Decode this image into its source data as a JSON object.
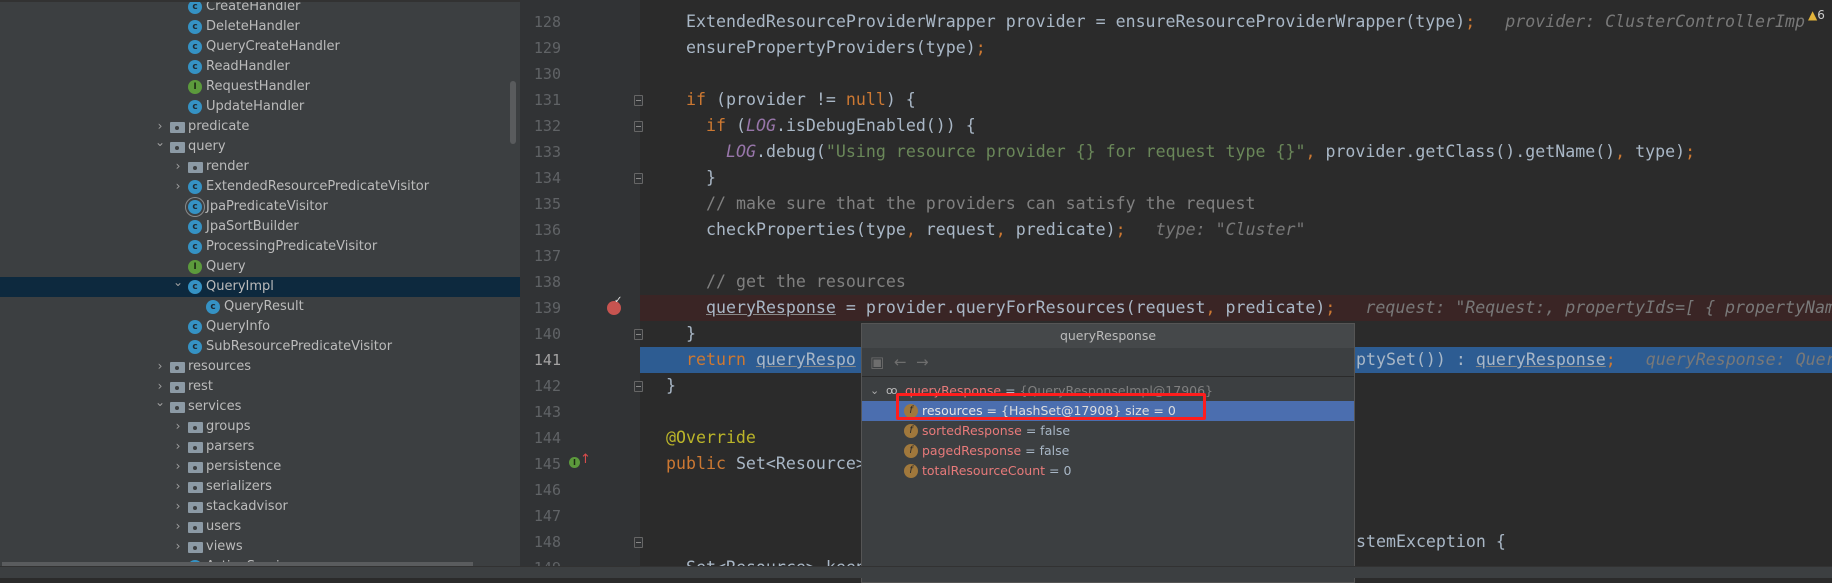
{
  "project_tree": [
    {
      "label": "CreateHandler",
      "icon": "class",
      "depth": 1,
      "expander": "none"
    },
    {
      "label": "DeleteHandler",
      "icon": "class",
      "depth": 1,
      "expander": "none"
    },
    {
      "label": "QueryCreateHandler",
      "icon": "class",
      "depth": 1,
      "expander": "none"
    },
    {
      "label": "ReadHandler",
      "icon": "class",
      "depth": 1,
      "expander": "none"
    },
    {
      "label": "RequestHandler",
      "icon": "interface",
      "depth": 1,
      "expander": "none"
    },
    {
      "label": "UpdateHandler",
      "icon": "class",
      "depth": 1,
      "expander": "none"
    },
    {
      "label": "predicate",
      "icon": "folder",
      "depth": 0,
      "expander": "collapsed"
    },
    {
      "label": "query",
      "icon": "folder",
      "depth": 0,
      "expander": "expanded"
    },
    {
      "label": "render",
      "icon": "folder",
      "depth": 1,
      "expander": "collapsed"
    },
    {
      "label": "ExtendedResourcePredicateVisitor",
      "icon": "class",
      "depth": 1,
      "expander": "collapsed"
    },
    {
      "label": "JpaPredicateVisitor",
      "icon": "abstract",
      "depth": 1,
      "expander": "none"
    },
    {
      "label": "JpaSortBuilder",
      "icon": "class",
      "depth": 1,
      "expander": "none"
    },
    {
      "label": "ProcessingPredicateVisitor",
      "icon": "class",
      "depth": 1,
      "expander": "none"
    },
    {
      "label": "Query",
      "icon": "interface",
      "depth": 1,
      "expander": "none"
    },
    {
      "label": "QueryImpl",
      "icon": "class",
      "depth": 1,
      "expander": "expanded",
      "selected": true
    },
    {
      "label": "QueryResult",
      "icon": "class",
      "depth": 2,
      "expander": "none"
    },
    {
      "label": "QueryInfo",
      "icon": "class",
      "depth": 1,
      "expander": "none"
    },
    {
      "label": "SubResourcePredicateVisitor",
      "icon": "class",
      "depth": 1,
      "expander": "none"
    },
    {
      "label": "resources",
      "icon": "folder",
      "depth": 0,
      "expander": "collapsed"
    },
    {
      "label": "rest",
      "icon": "folder",
      "depth": 0,
      "expander": "collapsed"
    },
    {
      "label": "services",
      "icon": "folder",
      "depth": 0,
      "expander": "expanded"
    },
    {
      "label": "groups",
      "icon": "folder",
      "depth": 1,
      "expander": "collapsed"
    },
    {
      "label": "parsers",
      "icon": "folder",
      "depth": 1,
      "expander": "collapsed"
    },
    {
      "label": "persistence",
      "icon": "folder",
      "depth": 1,
      "expander": "collapsed"
    },
    {
      "label": "serializers",
      "icon": "folder",
      "depth": 1,
      "expander": "collapsed"
    },
    {
      "label": "stackadvisor",
      "icon": "folder",
      "depth": 1,
      "expander": "collapsed"
    },
    {
      "label": "users",
      "icon": "folder",
      "depth": 1,
      "expander": "collapsed"
    },
    {
      "label": "views",
      "icon": "folder",
      "depth": 1,
      "expander": "collapsed"
    },
    {
      "label": "ActionService",
      "icon": "class",
      "depth": 1,
      "expander": "none"
    }
  ],
  "editor": {
    "warning_count": "6",
    "current_line": 141,
    "breakpoint_line": 139,
    "lines": [
      {
        "n": "128",
        "indent": 1,
        "tokens": [
          [
            "ExtendedResourceProviderWrapper provider = ensureResourceProviderWrapper(type)",
            ""
          ],
          [
            ";",
            "sep"
          ]
        ],
        "hint": "provider: ClusterControllerImp"
      },
      {
        "n": "129",
        "indent": 1,
        "tokens": [
          [
            "ensurePropertyProviders(type)",
            ""
          ],
          [
            ";",
            "sep"
          ]
        ]
      },
      {
        "n": "130",
        "indent": 1,
        "tokens": []
      },
      {
        "n": "131",
        "indent": 1,
        "fold": true,
        "tokens": [
          [
            "if",
            "kw"
          ],
          [
            " (provider != ",
            ""
          ],
          [
            "null",
            "kw"
          ],
          [
            ") {",
            ""
          ]
        ]
      },
      {
        "n": "132",
        "indent": 2,
        "fold": true,
        "tokens": [
          [
            "if",
            "kw"
          ],
          [
            " (",
            ""
          ],
          [
            "LOG",
            "log"
          ],
          [
            ".isDebugEnabled()) {",
            ""
          ]
        ]
      },
      {
        "n": "133",
        "indent": 3,
        "tokens": [
          [
            "LOG",
            "log"
          ],
          [
            ".debug(",
            ""
          ],
          [
            "\"Using resource provider {} for request type {}\"",
            "str"
          ],
          [
            ", ",
            "sep"
          ],
          [
            "provider.getClass().getName()",
            ""
          ],
          [
            ", ",
            "sep"
          ],
          [
            "type)",
            ""
          ],
          [
            ";",
            "sep"
          ]
        ]
      },
      {
        "n": "134",
        "indent": 2,
        "fold": true,
        "tokens": [
          [
            "}",
            ""
          ]
        ]
      },
      {
        "n": "135",
        "indent": 2,
        "tokens": [
          [
            "// make sure that the providers can satisfy the request",
            "cm"
          ]
        ]
      },
      {
        "n": "136",
        "indent": 2,
        "tokens": [
          [
            "checkProperties(type",
            ""
          ],
          [
            ", ",
            "sep"
          ],
          [
            "request",
            ""
          ],
          [
            ", ",
            "sep"
          ],
          [
            "predicate)",
            ""
          ],
          [
            ";",
            "sep"
          ]
        ],
        "hint": "type: \"Cluster\""
      },
      {
        "n": "137",
        "indent": 2,
        "tokens": []
      },
      {
        "n": "138",
        "indent": 2,
        "tokens": [
          [
            "// get the resources",
            "cm"
          ]
        ]
      },
      {
        "n": "139",
        "indent": 2,
        "tokens": [
          [
            "queryResponse",
            "ul"
          ],
          [
            " = provider.queryForResources(request",
            ""
          ],
          [
            ", ",
            "sep"
          ],
          [
            "predicate)",
            ""
          ],
          [
            ";",
            "sep"
          ]
        ],
        "hint": "request: \"Request:, propertyIds=[ { propertyName"
      },
      {
        "n": "140",
        "indent": 1,
        "fold": true,
        "tokens": [
          [
            "}",
            ""
          ]
        ]
      },
      {
        "n": "141",
        "indent": 1,
        "tokens": [
          [
            "return ",
            "kw"
          ],
          [
            "queryRespo",
            "ul"
          ]
        ],
        "right_tokens": [
          [
            "ptySet()) : ",
            ""
          ],
          [
            "queryResponse",
            "ul"
          ],
          [
            ";",
            "sep"
          ]
        ],
        "hint": "queryResponse: Quer"
      },
      {
        "n": "142",
        "indent": 0,
        "fold": true,
        "tokens": [
          [
            "}",
            ""
          ]
        ]
      },
      {
        "n": "143",
        "indent": 0,
        "tokens": []
      },
      {
        "n": "144",
        "indent": 0,
        "tokens": [
          [
            "@Override",
            "an"
          ]
        ]
      },
      {
        "n": "145",
        "indent": 0,
        "tokens": [
          [
            "public ",
            "kw"
          ],
          [
            "Set<Resource>",
            ""
          ]
        ]
      },
      {
        "n": "146",
        "indent": 0,
        "tokens": []
      },
      {
        "n": "147",
        "indent": 0,
        "tokens": []
      },
      {
        "n": "148",
        "indent": 0,
        "fold": true,
        "tokens": [],
        "right_tokens": [
          [
            "stemException {",
            ""
          ]
        ]
      },
      {
        "n": "149",
        "indent": 1,
        "tokens": [
          [
            "Set<Resource> keep",
            ""
          ]
        ]
      }
    ]
  },
  "popup": {
    "title": "queryResponse",
    "root": {
      "name": "queryResponse",
      "eq": " = ",
      "value": "{QueryResponseImpl@17906}"
    },
    "fields": [
      {
        "name": "resources",
        "eq": " = ",
        "value": "{HashSet@17908}  size = 0",
        "selected": true
      },
      {
        "name": "sortedResponse",
        "eq": " = ",
        "value": "false"
      },
      {
        "name": "pagedResponse",
        "eq": " = ",
        "value": "false"
      },
      {
        "name": "totalResourceCount",
        "eq": " = ",
        "value": "0"
      }
    ],
    "highlight_color": "#ff1d1d"
  }
}
